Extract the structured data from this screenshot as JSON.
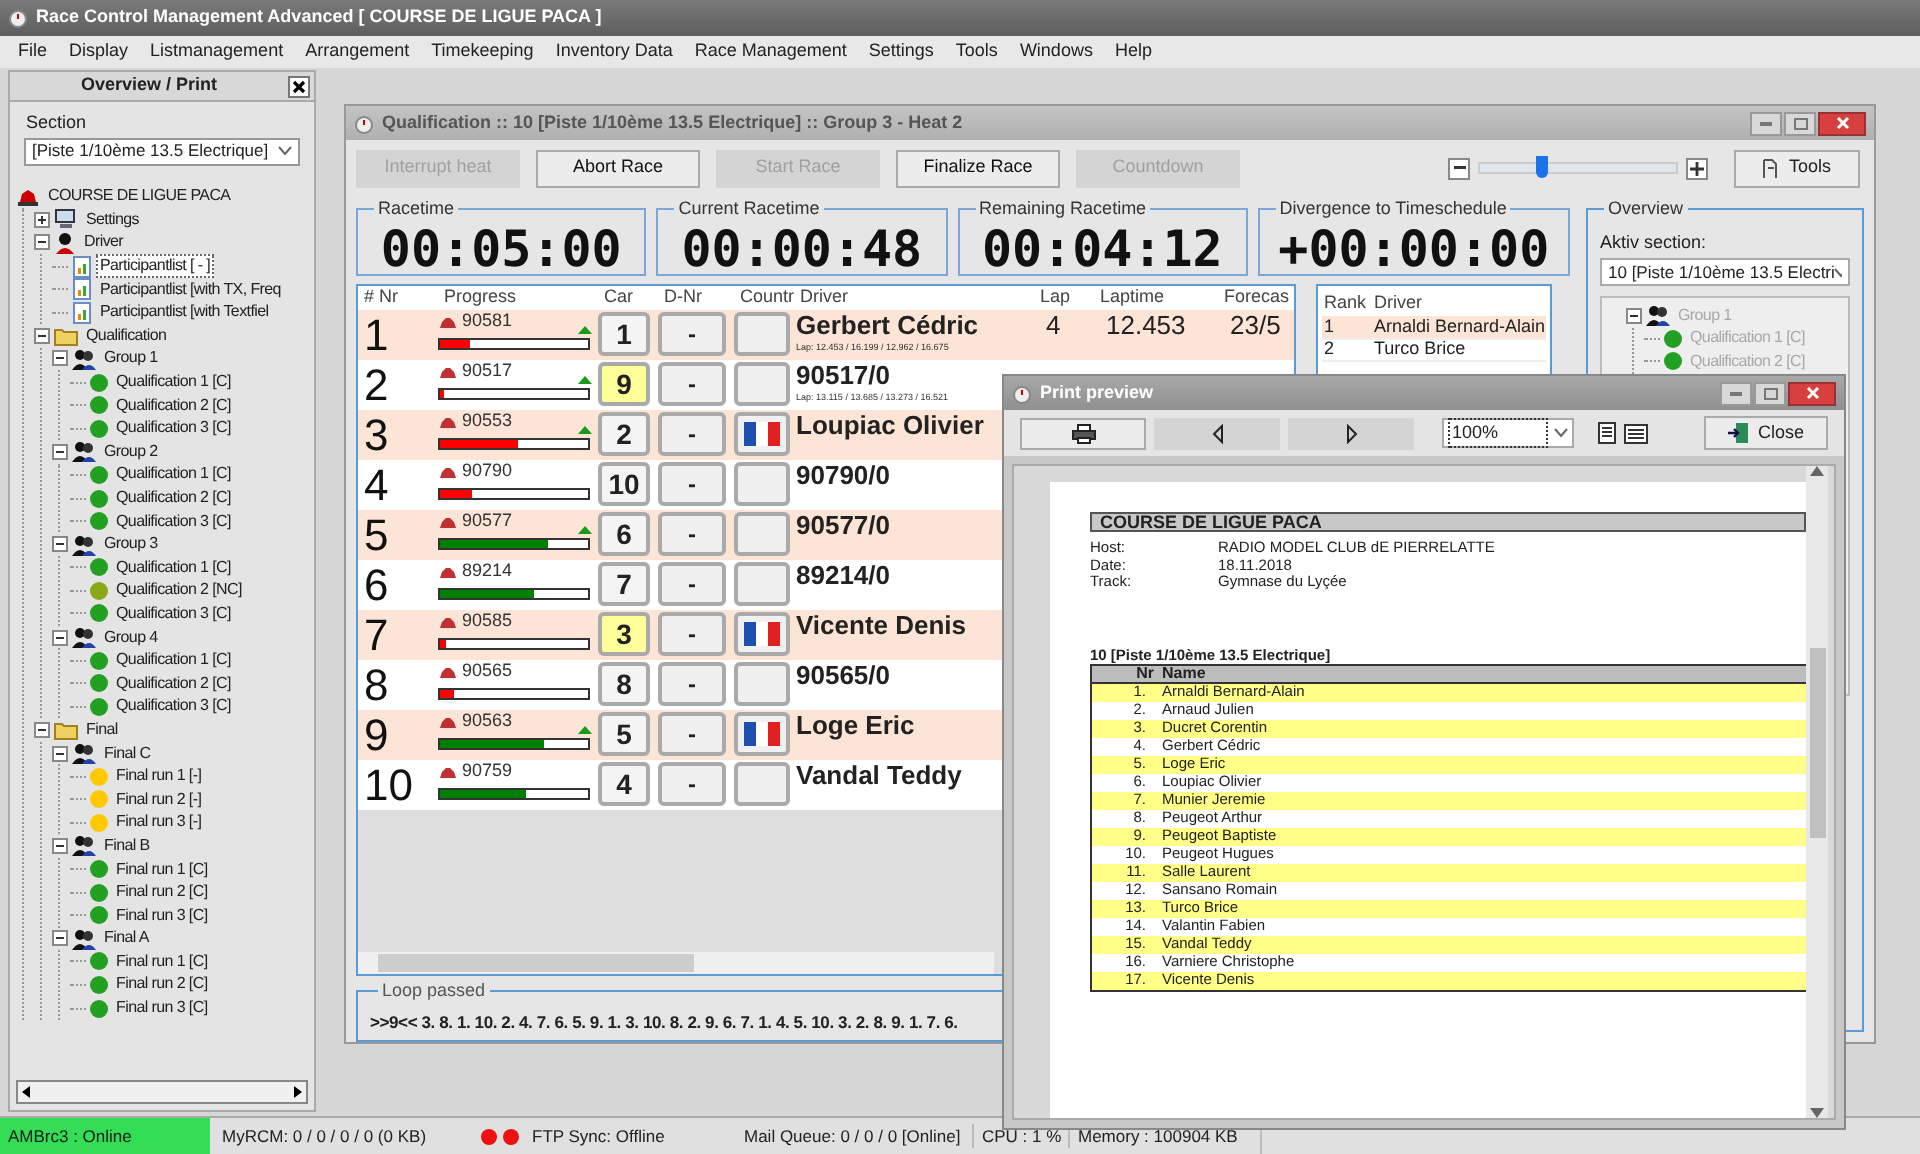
{
  "window": {
    "title": "Race Control Management Advanced  [ COURSE DE LIGUE PACA ]"
  },
  "menu": [
    "File",
    "Display",
    "Listmanagement",
    "Arrangement",
    "Timekeeping",
    "Inventory Data",
    "Race Management",
    "Settings",
    "Tools",
    "Windows",
    "Help"
  ],
  "sidebar": {
    "title": "Overview / Print",
    "section_label": "Section",
    "section_value": "[Piste 1/10ème 13.5 Electrique]",
    "tree": [
      {
        "label": "COURSE DE LIGUE PACA",
        "kind": "event",
        "selected": false,
        "children": [
          {
            "label": "Settings",
            "kind": "settings",
            "expanded": false,
            "selected": false
          },
          {
            "label": "Driver",
            "kind": "driver",
            "expanded": true,
            "selected": false,
            "children": [
              {
                "label": "Participantlist [ - ]",
                "kind": "list",
                "selected": true
              },
              {
                "label": "Participantlist [with TX, Freq",
                "kind": "list",
                "selected": false
              },
              {
                "label": "Participantlist [with Textfiel",
                "kind": "list",
                "selected": false
              }
            ]
          },
          {
            "label": "Qualification",
            "kind": "folder",
            "expanded": true,
            "selected": false,
            "children": [
              {
                "label": "Group 1",
                "kind": "group",
                "expanded": true,
                "selected": false,
                "children": [
                  {
                    "label": "Qualification 1  [C]",
                    "kind": "run",
                    "color": "#22a022",
                    "selected": false
                  },
                  {
                    "label": "Qualification 2  [C]",
                    "kind": "run",
                    "color": "#22a022",
                    "selected": false
                  },
                  {
                    "label": "Qualification 3  [C]",
                    "kind": "run",
                    "color": "#22a022",
                    "selected": false
                  }
                ]
              },
              {
                "label": "Group 2",
                "kind": "group",
                "expanded": true,
                "selected": false,
                "children": [
                  {
                    "label": "Qualification 1  [C]",
                    "kind": "run",
                    "color": "#22a022",
                    "selected": false
                  },
                  {
                    "label": "Qualification 2  [C]",
                    "kind": "run",
                    "color": "#22a022",
                    "selected": false
                  },
                  {
                    "label": "Qualification 3  [C]",
                    "kind": "run",
                    "color": "#22a022",
                    "selected": false
                  }
                ]
              },
              {
                "label": "Group 3",
                "kind": "group",
                "expanded": true,
                "selected": false,
                "children": [
                  {
                    "label": "Qualification 1  [C]",
                    "kind": "run",
                    "color": "#22a022",
                    "selected": false
                  },
                  {
                    "label": "Qualification 2  [NC]",
                    "kind": "run",
                    "color": "#8aa818",
                    "selected": false
                  },
                  {
                    "label": "Qualification 3  [C]",
                    "kind": "run",
                    "color": "#22a022",
                    "selected": false
                  }
                ]
              },
              {
                "label": "Group 4",
                "kind": "group",
                "expanded": true,
                "selected": false,
                "children": [
                  {
                    "label": "Qualification 1  [C]",
                    "kind": "run",
                    "color": "#22a022",
                    "selected": false
                  },
                  {
                    "label": "Qualification 2  [C]",
                    "kind": "run",
                    "color": "#22a022",
                    "selected": false
                  },
                  {
                    "label": "Qualification 3  [C]",
                    "kind": "run",
                    "color": "#22a022",
                    "selected": false
                  }
                ]
              }
            ]
          },
          {
            "label": "Final",
            "kind": "folder",
            "expanded": true,
            "selected": false,
            "children": [
              {
                "label": "Final C",
                "kind": "group",
                "expanded": true,
                "selected": false,
                "children": [
                  {
                    "label": "Final run 1  [-]",
                    "kind": "run",
                    "color": "#ffc800",
                    "selected": false
                  },
                  {
                    "label": "Final run 2  [-]",
                    "kind": "run",
                    "color": "#ffc800",
                    "selected": false
                  },
                  {
                    "label": "Final run 3  [-]",
                    "kind": "run",
                    "color": "#ffc800",
                    "selected": false
                  }
                ]
              },
              {
                "label": "Final B",
                "kind": "group",
                "expanded": true,
                "selected": false,
                "children": [
                  {
                    "label": "Final run 1  [C]",
                    "kind": "run",
                    "color": "#22a022",
                    "selected": false
                  },
                  {
                    "label": "Final run 2  [C]",
                    "kind": "run",
                    "color": "#22a022",
                    "selected": false
                  },
                  {
                    "label": "Final run 3  [C]",
                    "kind": "run",
                    "color": "#22a022",
                    "selected": false
                  }
                ]
              },
              {
                "label": "Final A",
                "kind": "group",
                "expanded": true,
                "selected": false,
                "children": [
                  {
                    "label": "Final run 1  [C]",
                    "kind": "run",
                    "color": "#22a022",
                    "selected": false
                  },
                  {
                    "label": "Final run 2  [C]",
                    "kind": "run",
                    "color": "#22a022",
                    "selected": false
                  },
                  {
                    "label": "Final run 3  [C]",
                    "kind": "run",
                    "color": "#22a022",
                    "selected": false
                  }
                ]
              }
            ]
          }
        ]
      }
    ]
  },
  "race": {
    "title": "Qualification :: 10  [Piste 1/10ème 13.5 Electrique] :: Group 3 - Heat 2",
    "buttons": [
      {
        "label": "Interrupt heat",
        "disabled": true
      },
      {
        "label": "Abort Race",
        "disabled": false
      },
      {
        "label": "Start Race",
        "disabled": true
      },
      {
        "label": "Finalize Race",
        "disabled": false
      },
      {
        "label": "Countdown",
        "disabled": true
      }
    ],
    "zoom": {
      "level": 0.32
    },
    "tools": "Tools",
    "timers": [
      {
        "label": "Racetime",
        "value": "00:05:00"
      },
      {
        "label": "Current Racetime",
        "value": "00:00:48"
      },
      {
        "label": "Remaining Racetime",
        "value": "00:04:12"
      },
      {
        "label": "Divergence to Timeschedule",
        "value": "+00:00:00"
      }
    ],
    "columns": [
      "# Nr",
      "Progress",
      "Car",
      "D-Nr",
      "Countr",
      "Driver",
      "Lap",
      "Laptime",
      "Forecas"
    ],
    "rows": [
      {
        "nr": "1",
        "transponder": "90581",
        "level": 0.2,
        "color": "#ff0000",
        "trend": true,
        "car": "1",
        "car_highlight": false,
        "dnr": "-",
        "flag": false,
        "driver": "Gerbert Cédric",
        "lap": "4",
        "laptime": "12.453",
        "forecast": "23/5",
        "detail": "Lap: 12.453 / 16.199 / 12.962 / 16.675"
      },
      {
        "nr": "2",
        "transponder": "90517",
        "level": 0.03,
        "color": "#ff0000",
        "trend": true,
        "car": "9",
        "car_highlight": true,
        "dnr": "-",
        "flag": false,
        "driver": "90517/0",
        "detail": "Lap: 13.115 / 13.685 / 13.273 / 16.521"
      },
      {
        "nr": "3",
        "transponder": "90553",
        "level": 0.53,
        "color": "#ff0000",
        "trend": true,
        "car": "2",
        "car_highlight": false,
        "dnr": "-",
        "flag": true,
        "driver": "Loupiac Olivier"
      },
      {
        "nr": "4",
        "transponder": "90790",
        "level": 0.22,
        "color": "#ff0000",
        "trend": false,
        "car": "10",
        "car_highlight": false,
        "dnr": "-",
        "flag": false,
        "driver": "90790/0"
      },
      {
        "nr": "5",
        "transponder": "90577",
        "level": 0.73,
        "color": "#008000",
        "trend": true,
        "car": "6",
        "car_highlight": false,
        "dnr": "-",
        "flag": false,
        "driver": "90577/0"
      },
      {
        "nr": "6",
        "transponder": "89214",
        "level": 0.63,
        "color": "#008000",
        "trend": false,
        "car": "7",
        "car_highlight": false,
        "dnr": "-",
        "flag": false,
        "driver": "89214/0"
      },
      {
        "nr": "7",
        "transponder": "90585",
        "level": 0.04,
        "color": "#ff0000",
        "trend": false,
        "car": "3",
        "car_highlight": true,
        "dnr": "-",
        "flag": true,
        "driver": "Vicente Denis"
      },
      {
        "nr": "8",
        "transponder": "90565",
        "level": 0.1,
        "color": "#ff0000",
        "trend": false,
        "car": "8",
        "car_highlight": false,
        "dnr": "-",
        "flag": false,
        "driver": "90565/0"
      },
      {
        "nr": "9",
        "transponder": "90563",
        "level": 0.7,
        "color": "#008000",
        "trend": true,
        "car": "5",
        "car_highlight": false,
        "dnr": "-",
        "flag": true,
        "driver": "Loge Eric"
      },
      {
        "nr": "10",
        "transponder": "90759",
        "level": 0.58,
        "color": "#008000",
        "trend": false,
        "car": "4",
        "car_highlight": false,
        "dnr": "-",
        "flag": false,
        "driver": "Vandal Teddy"
      }
    ],
    "rank": {
      "columns": [
        "Rank",
        "Driver"
      ],
      "rows": [
        {
          "rank": "1",
          "driver": "Arnaldi Bernard-Alain"
        },
        {
          "rank": "2",
          "driver": "Turco Brice"
        }
      ]
    },
    "loop": {
      "label": "Loop passed",
      "value": ">>9<< 3. 8. 1. 10. 2. 4. 7. 6. 5. 9. 1. 3. 10. 8. 2. 9. 6. 7. 1. 4. 5. 10. 3. 2. 8. 9. 1. 7. 6."
    },
    "overview": {
      "label": "Overview",
      "section_label": "Aktiv section:",
      "section_value": "10  [Piste 1/10ème 13.5 Electri",
      "tree": [
        {
          "label": "Group 1",
          "kind": "group",
          "expanded": true,
          "disabled": true,
          "children": [
            {
              "label": "Qualification 1  [C]",
              "kind": "run",
              "color": "#22a022",
              "disabled": true
            },
            {
              "label": "Qualification 2  [C]",
              "kind": "run",
              "color": "#22a022",
              "disabled": true
            }
          ]
        }
      ]
    }
  },
  "preview": {
    "title": "Print preview",
    "zoom": "100%",
    "close": "Close",
    "doc": {
      "title": "COURSE DE LIGUE PACA",
      "info": [
        {
          "label": "Host:",
          "value": "RADIO MODEL CLUB dE PIERRELATTE"
        },
        {
          "label": "Date:",
          "value": "18.11.2018"
        },
        {
          "label": "Track:",
          "value": "Gymnase du Lyçée"
        }
      ],
      "section": "10 [Piste 1/10ème 13.5 Electrique]",
      "columns": [
        "Nr",
        "Name"
      ],
      "rows": [
        {
          "nr": "1.",
          "name": "Arnaldi Bernard-Alain"
        },
        {
          "nr": "2.",
          "name": "Arnaud Julien"
        },
        {
          "nr": "3.",
          "name": "Ducret Corentin"
        },
        {
          "nr": "4.",
          "name": "Gerbert Cédric"
        },
        {
          "nr": "5.",
          "name": "Loge Eric"
        },
        {
          "nr": "6.",
          "name": "Loupiac Olivier"
        },
        {
          "nr": "7.",
          "name": "Munier Jeremie"
        },
        {
          "nr": "8.",
          "name": "Peugeot Arthur"
        },
        {
          "nr": "9.",
          "name": "Peugeot Baptiste"
        },
        {
          "nr": "10.",
          "name": "Peugeot Hugues"
        },
        {
          "nr": "11.",
          "name": "Salle Laurent"
        },
        {
          "nr": "12.",
          "name": "Sansano Romain"
        },
        {
          "nr": "13.",
          "name": "Turco Brice"
        },
        {
          "nr": "14.",
          "name": "Valantin Fabien"
        },
        {
          "nr": "15.",
          "name": "Vandal Teddy"
        },
        {
          "nr": "16.",
          "name": "Varniere Christophe"
        },
        {
          "nr": "17.",
          "name": "Vicente Denis"
        }
      ]
    }
  },
  "status_bar": {
    "timing": "AMBrc3 : Online",
    "timing_online": true,
    "myrcm": "MyRCM: 0 / 0 / 0 / 0 (0 KB)",
    "ftp": "FTP Sync: Offline",
    "ftp_online": false,
    "mail": "Mail Queue: 0 / 0 / 0 [Online]",
    "cpu": "CPU : 1 %",
    "memory": "Memory : 100904 KB"
  }
}
